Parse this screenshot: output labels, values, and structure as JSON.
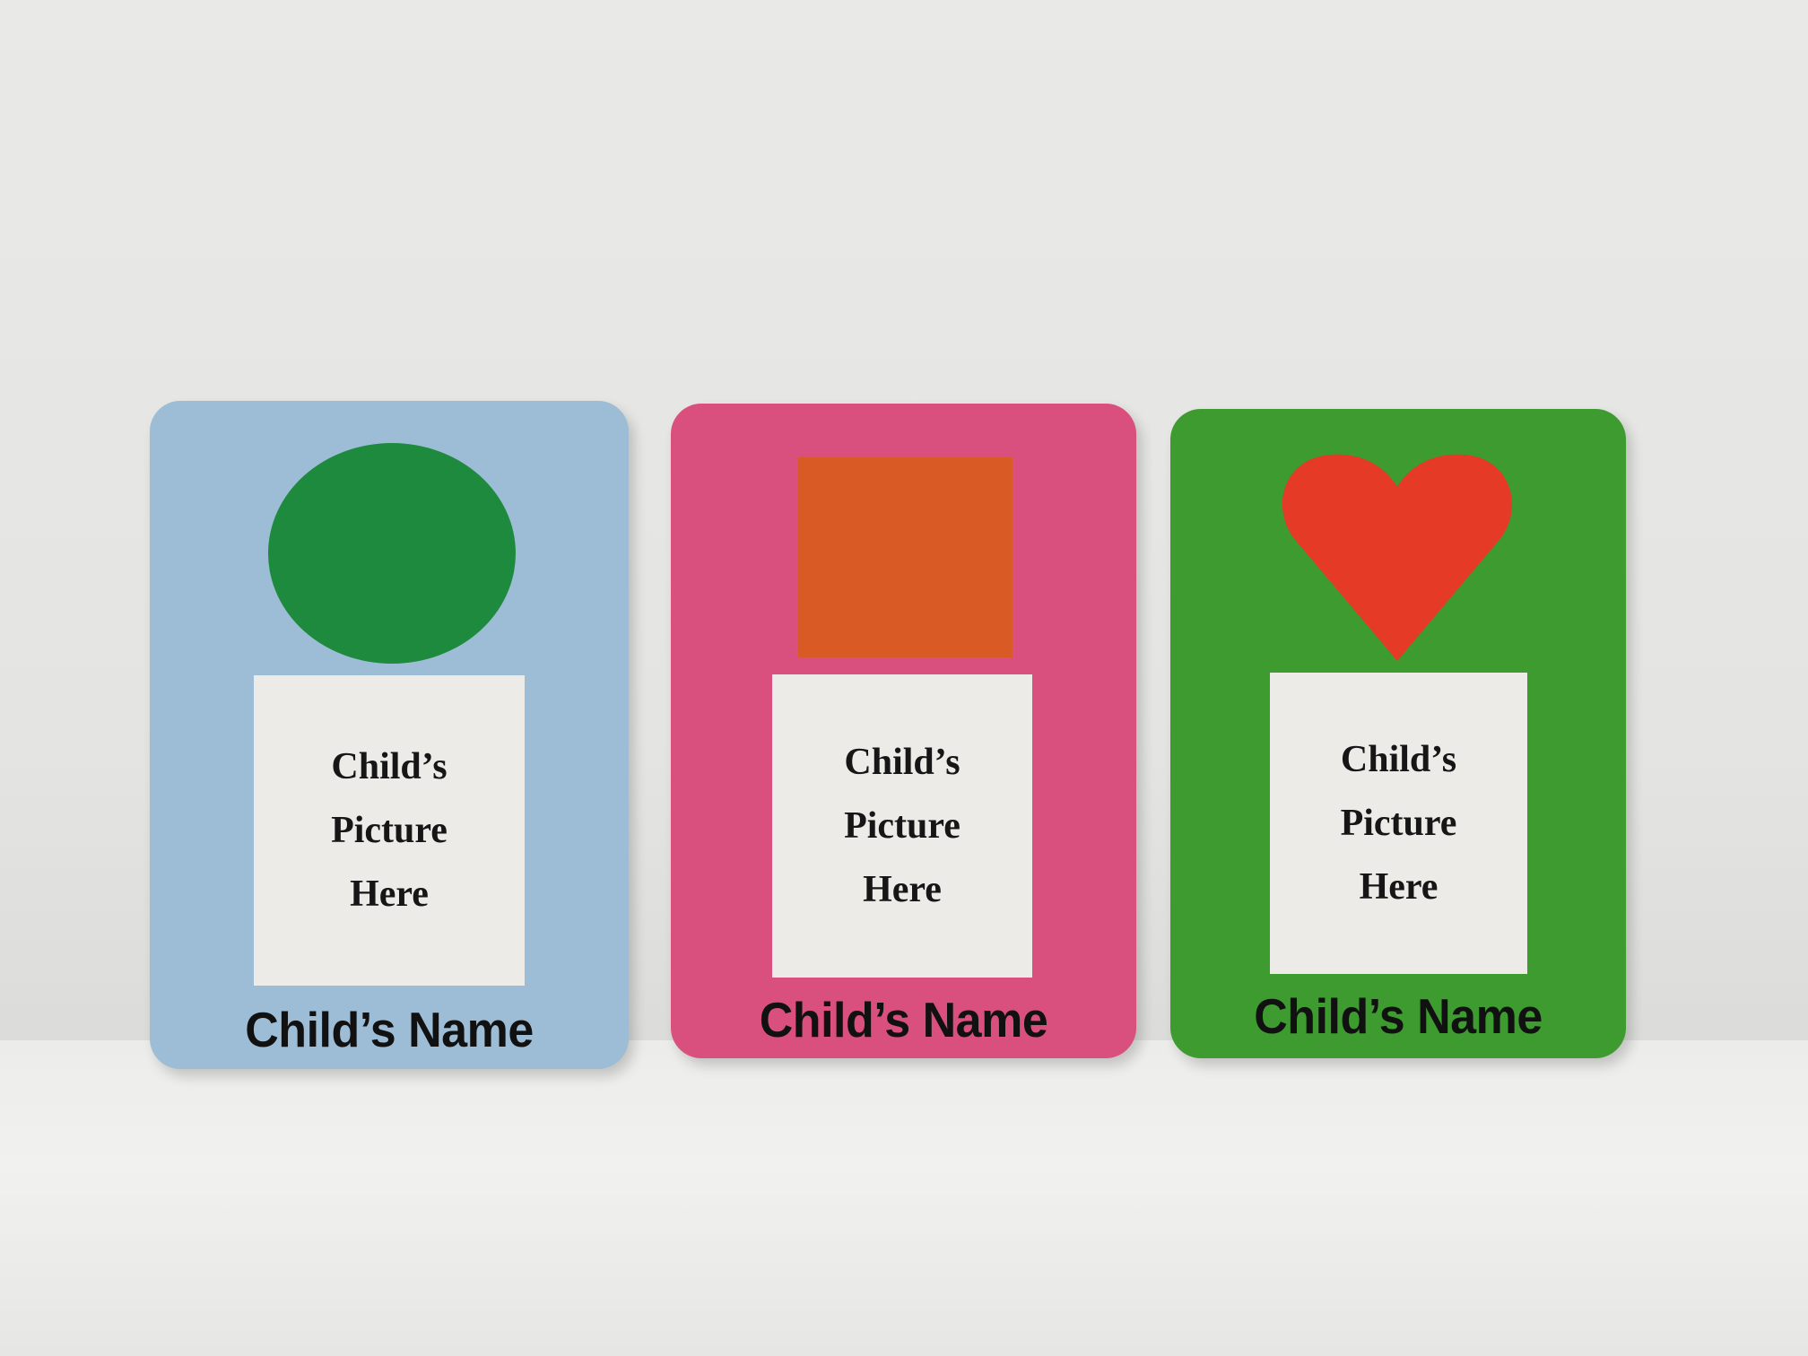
{
  "cards": [
    {
      "shape": "circle",
      "color": "#9dbdd6",
      "shape_color": "#1e8a3e",
      "picture_lines": [
        "Child’s",
        "Picture",
        "Here"
      ],
      "name": "Child’s Name"
    },
    {
      "shape": "square",
      "color": "#d9507f",
      "shape_color": "#d95a25",
      "picture_lines": [
        "Child’s",
        "Picture",
        "Here"
      ],
      "name": "Child’s Name"
    },
    {
      "shape": "heart",
      "color": "#3d9b30",
      "shape_color": "#e53a26",
      "picture_lines": [
        "Child’s",
        "Picture",
        "Here"
      ],
      "name": "Child’s Name"
    }
  ]
}
